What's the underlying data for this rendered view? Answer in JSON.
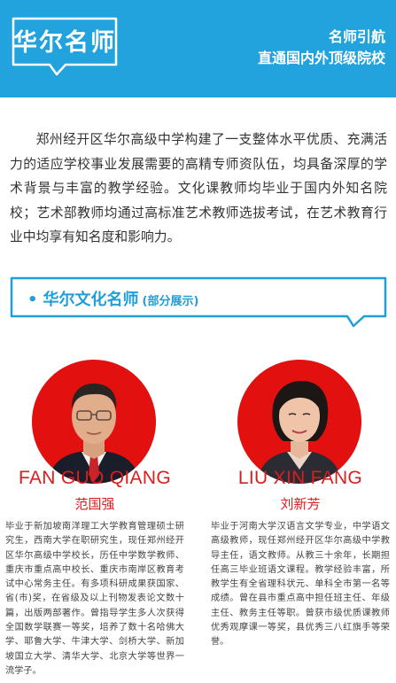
{
  "header": {
    "logo_text": "华尔名师",
    "tagline_1": "名师引航",
    "tagline_2": "直通国内外顶级院校",
    "bg_color": "#22a3dd"
  },
  "intro": {
    "paragraph": "郑州经开区华尔高级中学构建了一支整体水平优质、充满活力的适应学校事业发展需要的高精专师资队伍，均具备深厚的学术背景与丰富的教学经验。文化课教师均毕业于国内外知名院校；艺术部教师均通过高标准艺术教师选拔考试，在艺术教育行业中均享有知名度和影响力。"
  },
  "section": {
    "bullet": "•",
    "title": "华尔文化名师",
    "subtitle": "(部分展示)",
    "accent_color": "#1e9fd9"
  },
  "teachers": [
    {
      "name_en": "FAN GUO QIANG",
      "name_cn": "范国强",
      "bio": "毕业于新加坡南洋理工大学教育管理硕士研究生，西南大学在职研究生，现任郑州经开区华尔高级中学校长，历任中学数学教师、重庆市重点高中校长、重庆市南岸区教育考试中心常务主任。有多项科研成果获国家、省(市)奖，在省级及以上刊物发表论文数十篇，出版两部著作。曾指导学生多人次获得全国数学联赛一等奖，培养了数十名哈佛大学、耶鲁大学、牛津大学、剑桥大学、新加坡国立大学、清华大学、北京大学等世界一流学子。"
    },
    {
      "name_en": "LIU XIN FANG",
      "name_cn": "刘新芳",
      "bio": "毕业于河南大学汉语言文学专业，中学语文高级教师，现任郑州经开区华尔高级中学教导主任，语文教师。从教三十余年，长期担任高三毕业班语文课程。教学经验丰富，所教学生有全省理科状元、单科全市第一名等成绩。曾在县市重点高中担任班主任、年级主任、教务主任等职。曾获市级优质课教师优秀观摩课一等奖，县优秀三八红旗手等荣誉。"
    }
  ],
  "name_color": "#d81e1e",
  "avatar_bg": "#e31010"
}
